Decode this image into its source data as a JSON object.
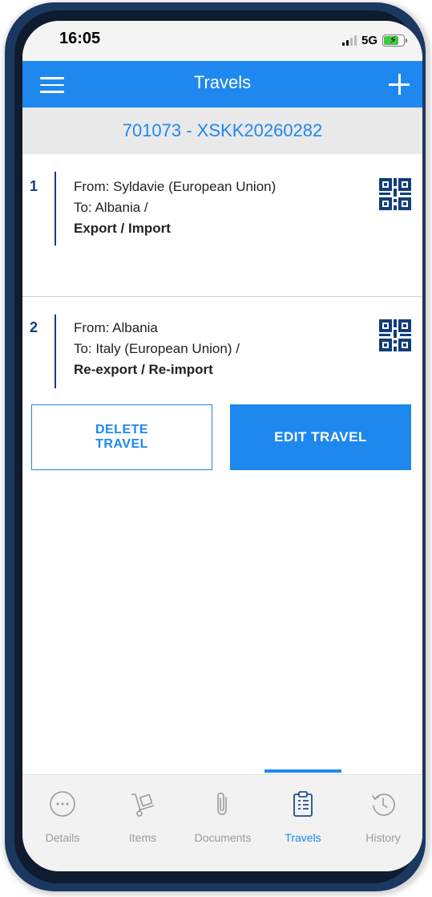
{
  "status_bar": {
    "time": "16:05",
    "network": "5G"
  },
  "header": {
    "title": "Travels"
  },
  "subheader": {
    "reference": "701073 - XSKK20260282"
  },
  "travels": [
    {
      "number": "1",
      "from": "From: Syldavie (European Union)",
      "to": "To: Albania /",
      "type": "Export / Import"
    },
    {
      "number": "2",
      "from": "From: Albania",
      "to": "To: Italy (European Union) /",
      "type": "Re-export / Re-import"
    }
  ],
  "actions": {
    "delete_line1": "DELETE",
    "delete_line2": "TRAVEL",
    "edit": "EDIT TRAVEL"
  },
  "nav": [
    {
      "label": "Details",
      "icon": "more-circle-icon"
    },
    {
      "label": "Items",
      "icon": "hand-truck-icon"
    },
    {
      "label": "Documents",
      "icon": "paperclip-icon"
    },
    {
      "label": "Travels",
      "icon": "clipboard-icon",
      "active": true
    },
    {
      "label": "History",
      "icon": "history-icon"
    }
  ],
  "colors": {
    "accent": "#1f88ee",
    "navy": "#123d7a"
  }
}
